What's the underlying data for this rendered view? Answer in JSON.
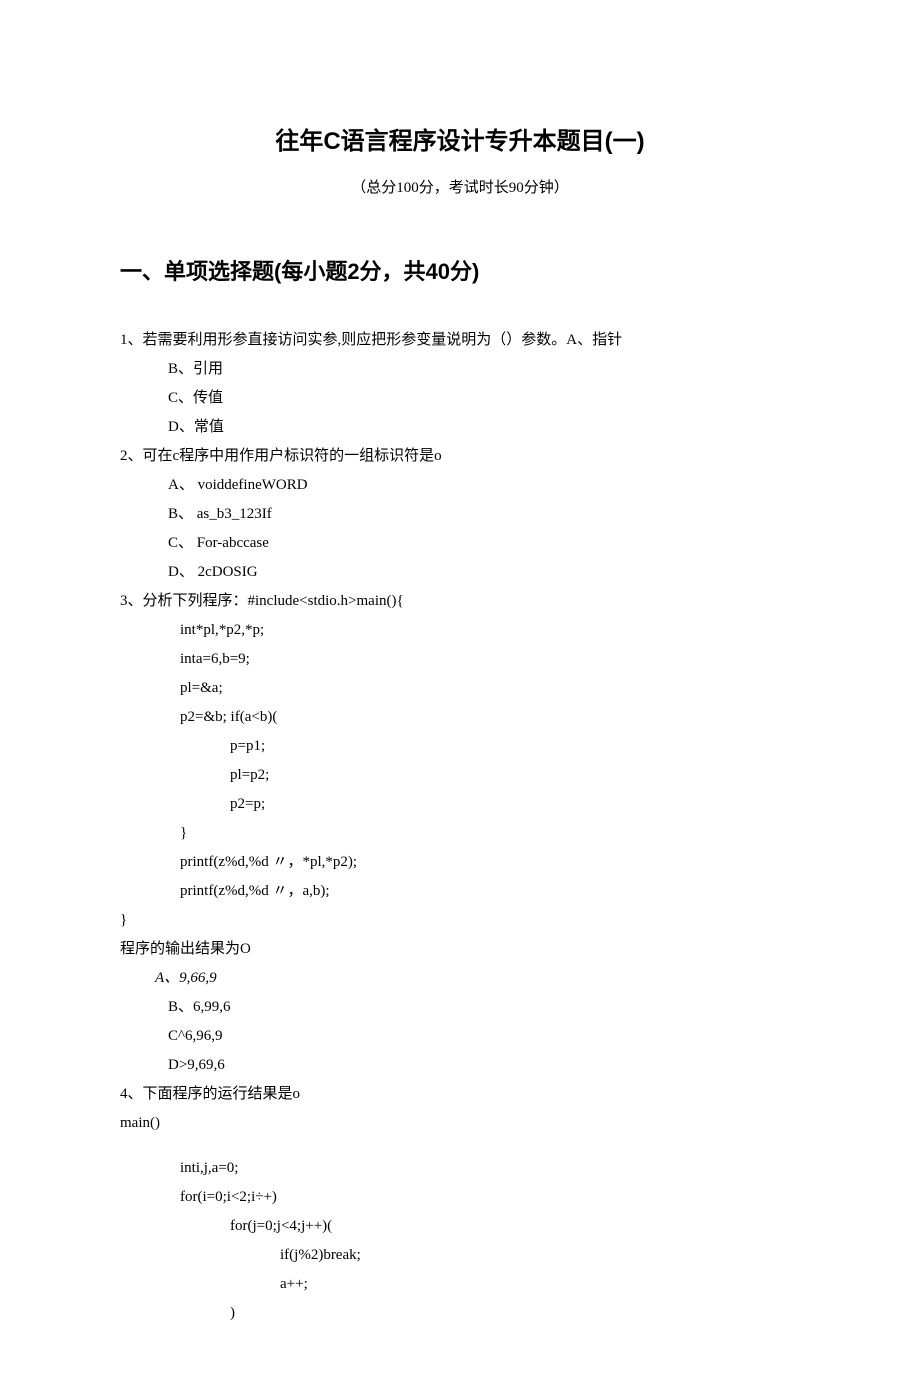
{
  "title": "往年C语言程序设计专升本题目(一)",
  "subtitle": "（总分100分，考试时长90分钟）",
  "section_header": "一、单项选择题(每小题2分，共40分)",
  "q1": {
    "text": "1、若需要利用形参直接访问实参,则应把形参变量说明为（）参数。A、指针",
    "option_b": "B、引用",
    "option_c": "C、传值",
    "option_d": "D、常值"
  },
  "q2": {
    "text": "2、可在c程序中用作用户标识符的一组标识符是o",
    "option_a": "A、 voiddefineWORD",
    "option_b": "B、 as_b3_123If",
    "option_c": "C、 For-abccase",
    "option_d": "D、 2cDOSIG"
  },
  "q3": {
    "text": "3、分析下列程序：#include<stdio.h>main(){",
    "code_1": "int*pl,*p2,*p;",
    "code_2": "inta=6,b=9;",
    "code_3": "pl=&a;",
    "code_4": "p2=&b;  if(a<b)(",
    "code_5": "p=p1;",
    "code_6": "pl=p2;",
    "code_7": "p2=p;",
    "code_8": "}",
    "code_9": "printf(z%d,%d 〃，*pl,*p2);",
    "code_10": "printf(z%d,%d 〃，a,b);",
    "code_end": "}",
    "result_text": "程序的输出结果为O",
    "option_a": "A、9,66,9",
    "option_b": "B、6,99,6",
    "option_c": "C^6,96,9",
    "option_d": "D>9,69,6"
  },
  "q4": {
    "text": "4、下面程序的运行结果是o",
    "main": "main()",
    "code_1": "inti,j,a=0;",
    "code_2": "for(i=0;i<2;i÷+)",
    "code_3": "for(j=0;j<4;j++)(",
    "code_4": "if(j%2)break;",
    "code_5": "a++;",
    "code_6": ")"
  }
}
